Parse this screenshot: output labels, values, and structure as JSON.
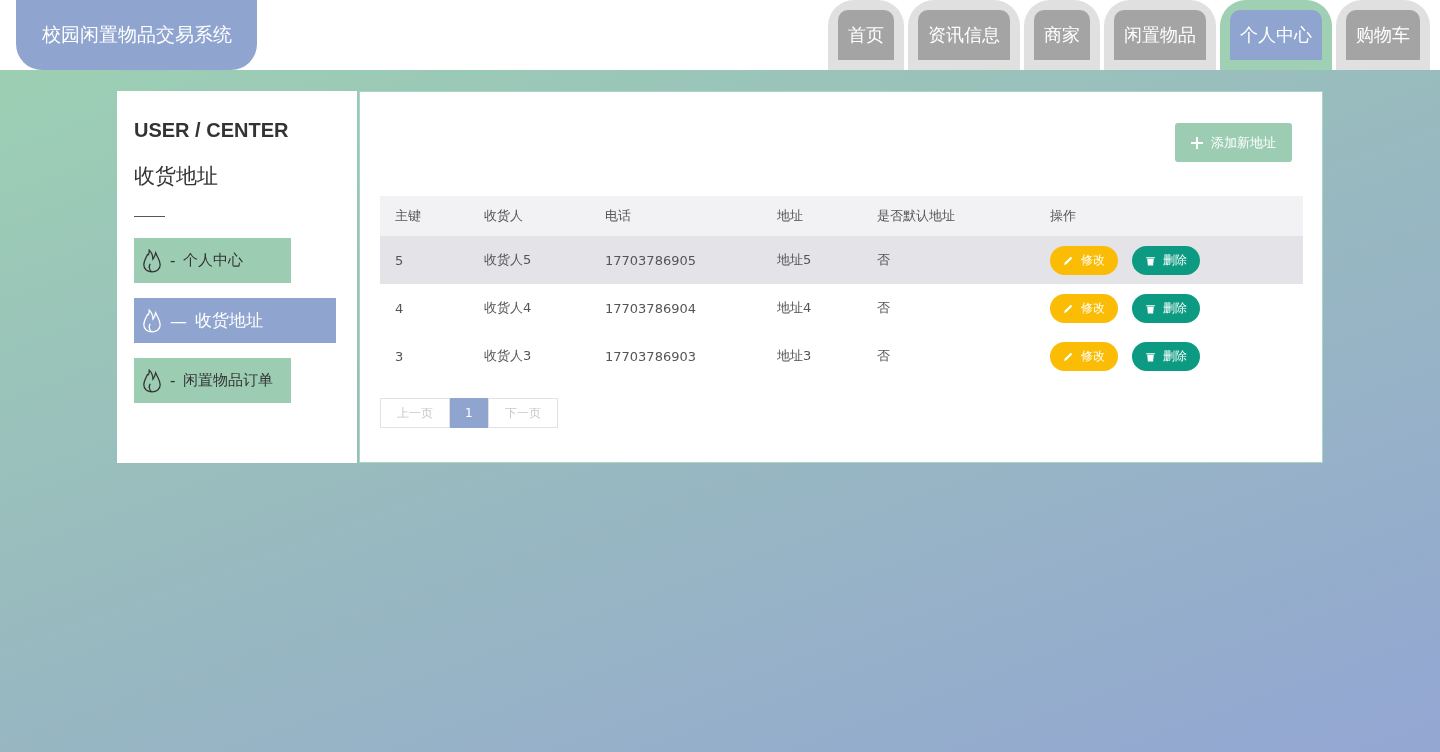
{
  "header": {
    "title": "校园闲置物品交易系统"
  },
  "nav": [
    {
      "label": "首页",
      "selected": false
    },
    {
      "label": "资讯信息",
      "selected": false
    },
    {
      "label": "商家",
      "selected": false
    },
    {
      "label": "闲置物品",
      "selected": false
    },
    {
      "label": "个人中心",
      "selected": true
    },
    {
      "label": "购物车",
      "selected": false
    }
  ],
  "sidebar": {
    "heading": "USER / CENTER",
    "subtitle": "收货地址",
    "items": [
      {
        "dash": "-",
        "label": "个人中心",
        "selected": false
      },
      {
        "dash": "—",
        "label": "收货地址",
        "selected": true
      },
      {
        "dash": "-",
        "label": "闲置物品订单",
        "selected": false
      }
    ]
  },
  "add_button": "添加新地址",
  "table": {
    "columns": [
      "主键",
      "收货人",
      "电话",
      "地址",
      "是否默认地址",
      "操作"
    ],
    "rows": [
      {
        "cells": [
          "5",
          "收货人5",
          "17703786905",
          "地址5",
          "否"
        ],
        "highlighted": true,
        "edit": "修改",
        "delete": "删除"
      },
      {
        "cells": [
          "4",
          "收货人4",
          "17703786904",
          "地址4",
          "否"
        ],
        "highlighted": false,
        "edit": "修改",
        "delete": "删除"
      },
      {
        "cells": [
          "3",
          "收货人3",
          "17703786903",
          "地址3",
          "否"
        ],
        "highlighted": false,
        "edit": "修改",
        "delete": "删除"
      }
    ]
  },
  "pagination": {
    "prev": "上一页",
    "pages": [
      {
        "label": "1",
        "selected": true
      }
    ],
    "next": "下一页"
  }
}
